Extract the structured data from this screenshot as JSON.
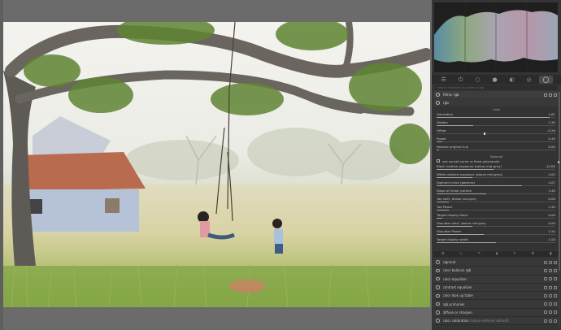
{
  "panel": {
    "search_placeholder": "search modules by name or tag",
    "tabs": [
      "quick-access-icon",
      "power-icon",
      "circle-icon",
      "color-dots-icon",
      "drop-icon",
      "correct-icon",
      "active-circle-icon"
    ],
    "filmic_header": "filmic rgb",
    "filmic_sub": "rgb",
    "look_title": "Look",
    "look_sliders": [
      {
        "label": "Saturation",
        "value": "1.61",
        "fill": 0.95
      },
      {
        "label": "Hidden",
        "value": "1.30",
        "fill": 0.31
      },
      {
        "label": "Offset",
        "value": "-0.26",
        "fill": 0.4
      },
      {
        "label": "Power",
        "value": "0.49",
        "fill": 0.05
      },
      {
        "label": "Restore original hue",
        "value": "0.00",
        "fill": 0.02
      }
    ],
    "sigmoid_title": "Sigmoid",
    "checkbox_label": "use sunset curve vs fixed polynomial",
    "sigmoid_sliders": [
      {
        "label": "Black relative exposure (below mid-grey)",
        "value": "-10.00",
        "fill": 0.48
      },
      {
        "label": "White relative exposure (above mid-grey)",
        "value": "4.05",
        "fill": 0.3
      },
      {
        "label": "Sigmoid curve (gamma)",
        "value": "4.07",
        "fill": 0.72
      },
      {
        "label": "Slope of linear portion",
        "value": "3.40",
        "fill": 0.42
      },
      {
        "label": "Toe shift, below mid-grey",
        "value": "0.00",
        "fill": 0.1
      },
      {
        "label": "Toe Power",
        "value": "1.50",
        "fill": 0.1
      },
      {
        "label": "Target display black",
        "value": "0.00",
        "fill": 0.05
      },
      {
        "label": "Shoulder start, above mid-grey",
        "value": "0.00",
        "fill": 0.3
      },
      {
        "label": "Shoulder Power",
        "value": "1.50",
        "fill": 0.4
      },
      {
        "label": "Target display white",
        "value": "1.00",
        "fill": 0.5
      }
    ],
    "modules": [
      "sigmoid",
      "color balance rgb",
      "color equalizer",
      "contrast equalizer",
      "color look up table",
      "rgb primaries",
      "diffuse or sharpen",
      "color calibration"
    ],
    "color_calibration_note": "(scene-referred default)"
  }
}
